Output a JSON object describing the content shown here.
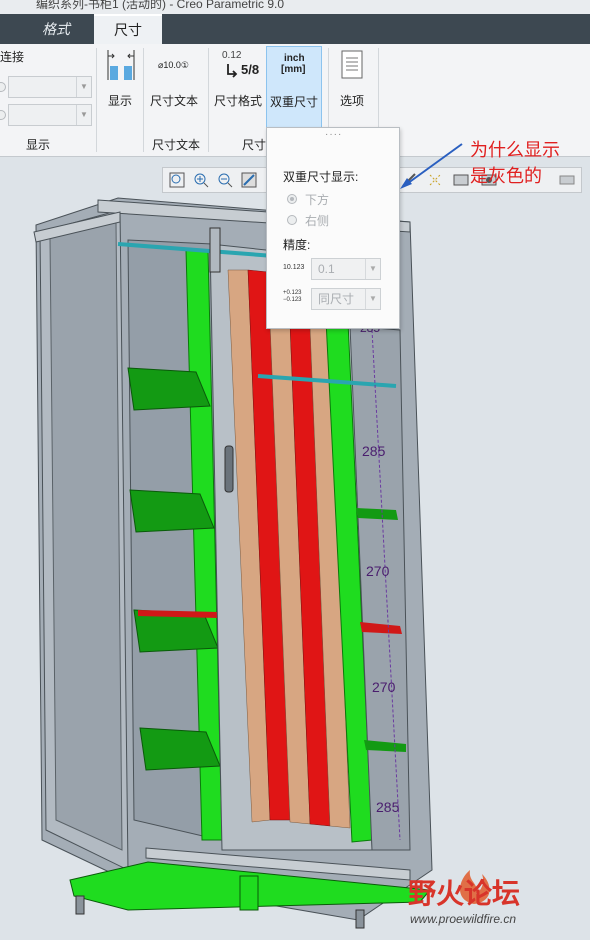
{
  "window": {
    "title": "编织系列-书柜1 (活动的) - Creo Parametric 9.0"
  },
  "tabs": [
    {
      "label": "格式",
      "active": false
    },
    {
      "label": "尺寸",
      "active": true
    }
  ],
  "ribbon": {
    "connect_label": "连接",
    "groups": [
      {
        "label": "显示"
      },
      {
        "label": "尺寸文本"
      },
      {
        "label": "尺寸"
      }
    ],
    "buttons": {
      "display": "显示",
      "dim_text": "尺寸文本",
      "dim_text_icon": "⌀10.0①",
      "dim_format": "尺寸格式",
      "dim_format_frac": "0.12",
      "dim_format_big": "5/8",
      "dual_dim": "双重尺寸",
      "dual_icon_top": "inch",
      "dual_icon_bottom": "[mm]",
      "options": "选项"
    }
  },
  "dual_panel": {
    "title": "双重尺寸显示:",
    "option_below": "下方",
    "option_right": "右侧",
    "selected": "下方",
    "precision_label": "精度:",
    "precision_icon": "10.123",
    "precision_value": "0.1",
    "tolerance_icon_top": "+0.123",
    "tolerance_icon_bottom": "−0.123",
    "tolerance_value": "同尺寸"
  },
  "annotation": {
    "line1": "为什么显示",
    "line2": "是灰色的",
    "color": "#e02020"
  },
  "model": {
    "dimensions": [
      "285",
      "270",
      "270",
      "285"
    ],
    "top_small_dim": "285"
  },
  "watermark": {
    "brand": "野火论坛",
    "url": "www.proewildfire.cn"
  }
}
